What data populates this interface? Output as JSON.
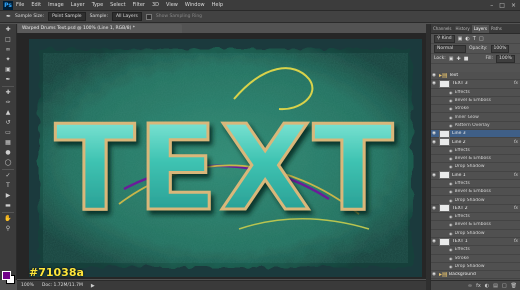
{
  "app": {
    "logo": "Ps"
  },
  "menu": [
    "File",
    "Edit",
    "Image",
    "Layer",
    "Type",
    "Select",
    "Filter",
    "3D",
    "View",
    "Window",
    "Help"
  ],
  "options": {
    "sample_size_label": "Sample Size:",
    "sample_size_value": "Point Sample",
    "sample_label": "Sample:",
    "sample_value": "All Layers",
    "show_ring_label": "Show Sampling Ring"
  },
  "document": {
    "tab_title": "Warped Drums Text.psd @ 100% (Line 1, RGB/8) *",
    "canvas_text": "TEXT"
  },
  "status": {
    "zoom": "100%",
    "doc_size": "Doc: 1.72M/11.7M"
  },
  "color_label": "#71038a",
  "colors": {
    "foreground": "#71038a",
    "background": "#ffffff"
  },
  "panel": {
    "tabs": [
      "Channels",
      "History",
      "Layers",
      "Paths"
    ],
    "kind_label": "Kind",
    "blend_mode": "Normal",
    "opacity_label": "Opacity:",
    "opacity_value": "100%",
    "lock_label": "Lock:",
    "fill_label": "Fill:",
    "fill_value": "100%"
  },
  "layers": [
    {
      "name": "Text",
      "kind": "group"
    },
    {
      "name": "TEXT 3",
      "kind": "layer",
      "fx": "fx"
    },
    {
      "name": "Effects",
      "kind": "effect"
    },
    {
      "name": "Bevel & Emboss",
      "kind": "effect"
    },
    {
      "name": "Stroke",
      "kind": "effect"
    },
    {
      "name": "Inner Glow",
      "kind": "effect"
    },
    {
      "name": "Pattern Overlay",
      "kind": "effect"
    },
    {
      "name": "Line 3",
      "kind": "layer",
      "selected": true
    },
    {
      "name": "Line 2",
      "kind": "layer",
      "fx": "fx"
    },
    {
      "name": "Effects",
      "kind": "effect"
    },
    {
      "name": "Bevel & Emboss",
      "kind": "effect"
    },
    {
      "name": "Drop Shadow",
      "kind": "effect"
    },
    {
      "name": "Line 1",
      "kind": "layer",
      "fx": "fx"
    },
    {
      "name": "Effects",
      "kind": "effect"
    },
    {
      "name": "Bevel & Emboss",
      "kind": "effect"
    },
    {
      "name": "Drop Shadow",
      "kind": "effect"
    },
    {
      "name": "TEXT 2",
      "kind": "layer",
      "fx": "fx"
    },
    {
      "name": "Effects",
      "kind": "effect"
    },
    {
      "name": "Bevel & Emboss",
      "kind": "effect"
    },
    {
      "name": "Drop Shadow",
      "kind": "effect"
    },
    {
      "name": "TEXT 1",
      "kind": "layer",
      "fx": "fx"
    },
    {
      "name": "Effects",
      "kind": "effect"
    },
    {
      "name": "Stroke",
      "kind": "effect"
    },
    {
      "name": "Drop Shadow",
      "kind": "effect"
    },
    {
      "name": "Background",
      "kind": "group"
    }
  ]
}
